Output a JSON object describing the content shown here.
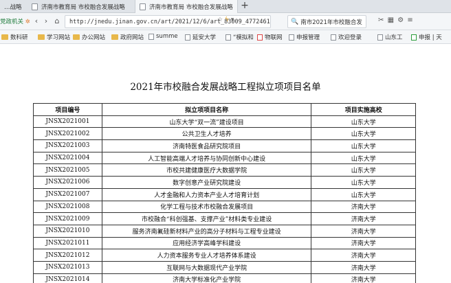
{
  "browser": {
    "tabs": [
      {
        "title": "…战略"
      },
      {
        "title": "济南市教育局 市校融合发展战略"
      },
      {
        "title": "济南市教育局 市校融合发展战略"
      }
    ],
    "gov_label": "党政机关",
    "url": "http://jnedu.jinan.gov.cn/art/2021/12/6/art_83009_4772461.h",
    "search_text": "南市2021年市校融合发",
    "bookmarks": [
      "数科研",
      "学习网站",
      "办公网站",
      "政府网站",
      "summe",
      "延安大学",
      "“模拟和",
      "物联网",
      "申报管理",
      "欢迎登录",
      "山东工",
      "申报 | 天"
    ]
  },
  "page": {
    "title": "2021年市校融合发展战略工程拟立项项目名单",
    "headers": [
      "项目编号",
      "拟立项项目名称",
      "项目实施高校"
    ],
    "rows": [
      [
        "JNSX2021001",
        "山东大学“双一流”建设项目",
        "山东大学"
      ],
      [
        "JNSX2021002",
        "公共卫生人才培养",
        "山东大学"
      ],
      [
        "JNSX2021003",
        "济南特医食品研究院项目",
        "山东大学"
      ],
      [
        "JNSX2021004",
        "人工智能高端人才培养与协同创新中心建设",
        "山东大学"
      ],
      [
        "JNSX2021005",
        "市校共建健康医疗大数据学院",
        "山东大学"
      ],
      [
        "JNSX2021006",
        "数字创意产业研究院建设",
        "山东大学"
      ],
      [
        "JNSX2021007",
        "人才金融和人力资本产业人才培育计划",
        "山东大学"
      ],
      [
        "JNSX2021008",
        "化学工程与技术市校融合发展项目",
        "济南大学"
      ],
      [
        "JNSX2021009",
        "市校融合“科创强基、支撑产业”材料类专业建设",
        "济南大学"
      ],
      [
        "JNSX2021010",
        "服务济南氟硅新材料产业的高分子材料与工程专业建设",
        "济南大学"
      ],
      [
        "JNSX2021011",
        "应用经济学高峰学科建设",
        "济南大学"
      ],
      [
        "JNSX2021012",
        "人力资本服务专业人才培养体系建设",
        "济南大学"
      ],
      [
        "JNSX2021013",
        "互联网与大数据现代产业学院",
        "济南大学"
      ],
      [
        "JNSX2021014",
        "济南大学标准化产业学院",
        "济南大学"
      ]
    ]
  }
}
